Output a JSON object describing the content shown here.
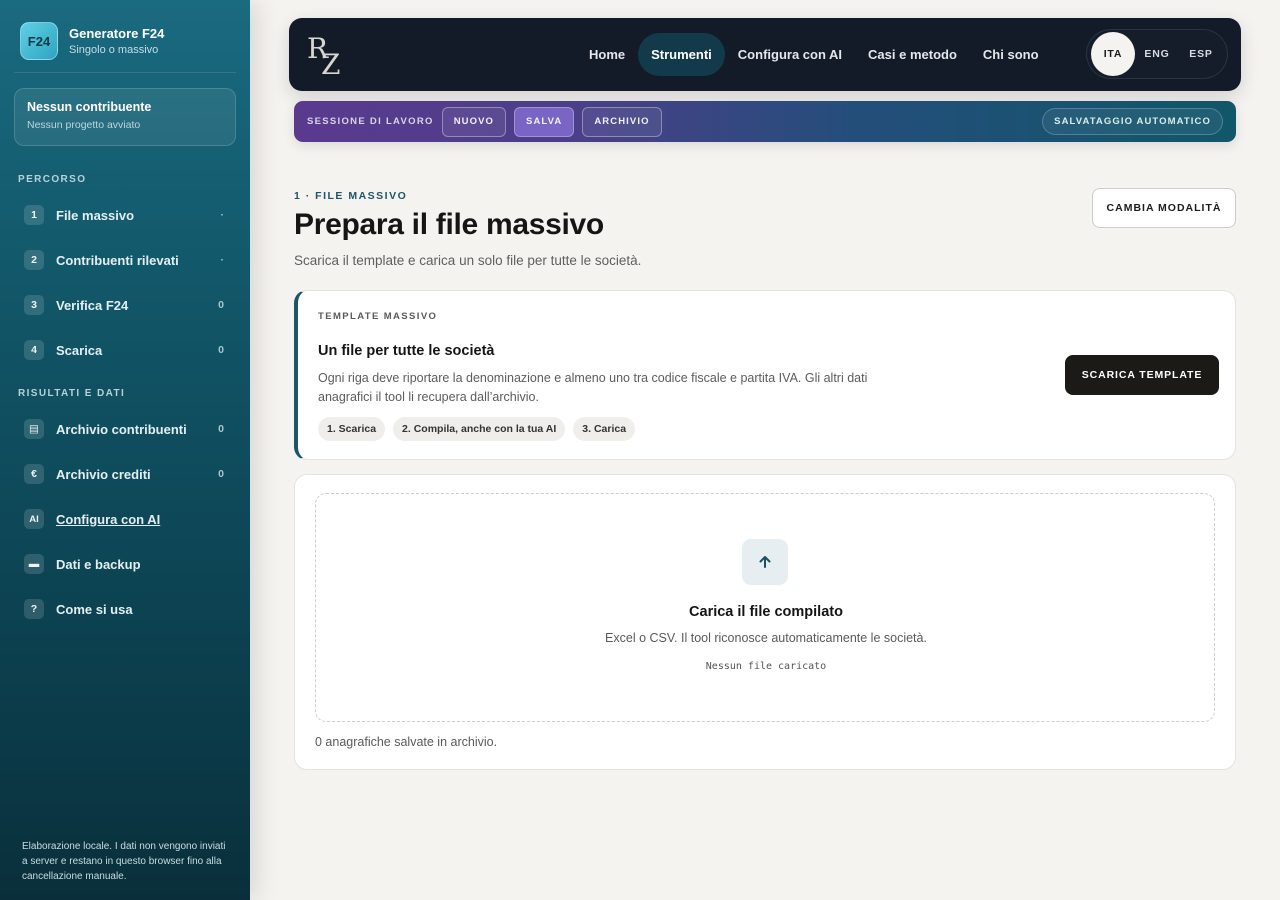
{
  "sidebar": {
    "brand": {
      "logo": "F24",
      "title": "Generatore F24",
      "subtitle": "Singolo o massivo"
    },
    "contributor": {
      "title": "Nessun contribuente",
      "subtitle": "Nessun progetto avviato"
    },
    "sections": {
      "path": "PERCORSO",
      "results": "RISULTATI E DATI"
    },
    "path_items": [
      {
        "num": "1",
        "label": "File massivo",
        "count": "·"
      },
      {
        "num": "2",
        "label": "Contribuenti rilevati",
        "count": "·"
      },
      {
        "num": "3",
        "label": "Verifica F24",
        "count": "0"
      },
      {
        "num": "4",
        "label": "Scarica",
        "count": "0"
      }
    ],
    "data_items": [
      {
        "icon": "▤",
        "icon_name": "contacts-archive-icon",
        "label": "Archivio contribuenti",
        "count": "0"
      },
      {
        "icon": "€",
        "icon_name": "euro-icon",
        "label": "Archivio crediti",
        "count": "0"
      },
      {
        "icon": "AI",
        "icon_name": "ai-icon",
        "label": "Configura con AI",
        "count": ""
      },
      {
        "icon": "▬",
        "icon_name": "backup-icon",
        "label": "Dati e backup",
        "count": ""
      },
      {
        "icon": "?",
        "icon_name": "help-icon",
        "label": "Come si usa",
        "count": ""
      }
    ],
    "footer": "Elaborazione locale. I dati non vengono inviati a server e restano in questo browser fino alla cancellazione manuale."
  },
  "topnav": {
    "logo": {
      "r": "R",
      "z": "Z"
    },
    "links": [
      "Home",
      "Strumenti",
      "Configura con AI",
      "Casi e metodo",
      "Chi sono"
    ],
    "active_link": "Strumenti",
    "languages": [
      "ITA",
      "ENG",
      "ESP"
    ],
    "active_language": "ITA"
  },
  "session": {
    "label": "SESSIONE DI LAVORO",
    "new": "NUOVO",
    "save": "SALVA",
    "archive": "ARCHIVIO",
    "autosave": "SALVATAGGIO AUTOMATICO"
  },
  "main": {
    "step": "1 · FILE MASSIVO",
    "title": "Prepara il file massivo",
    "subtitle": "Scarica il template e carica un solo file per tutte le società.",
    "mode_button": "CAMBIA MODALITÀ",
    "template": {
      "eyebrow": "TEMPLATE MASSIVO",
      "title": "Un file per tutte le società",
      "description": "Ogni riga deve riportare la denominazione e almeno uno tra codice fiscale e partita IVA. Gli altri dati anagrafici il tool li recupera dall’archivio.",
      "chips": [
        "1. Scarica",
        "2. Compila, anche con la tua AI",
        "3. Carica"
      ],
      "download_button": "SCARICA TEMPLATE"
    },
    "upload": {
      "icon": "arrow-up-icon",
      "title": "Carica il file compilato",
      "subtitle": "Excel o CSV. Il tool riconosce automaticamente le società.",
      "status": "Nessun file caricato",
      "saved_note": "0 anagrafiche salvate in archivio."
    }
  },
  "colors": {
    "sidebar_top": "#1a6a80",
    "sidebar_bottom": "#0a2f3b",
    "nav_bg": "#131a28",
    "accent": "#1b5568",
    "session_purple": "#5b3a8e",
    "dark_button": "#1c1a16"
  }
}
